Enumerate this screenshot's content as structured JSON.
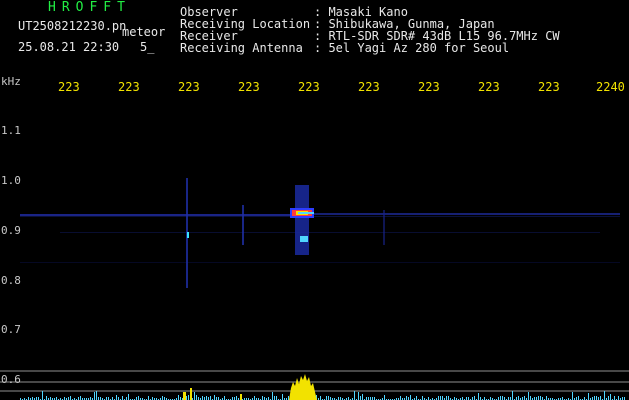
{
  "brand": "HROFFT",
  "file_name": "UT2508212230.pn",
  "mode": "meteor",
  "date_time": "25.08.21 22:30",
  "count": "5_",
  "info": [
    {
      "label": "Observer",
      "value": ": Masaki Kano"
    },
    {
      "label": "Receiving Location",
      "value": ": Shibukawa, Gunma, Japan"
    },
    {
      "label": "Receiver",
      "value": ": RTL-SDR SDR# 43dB L15 96.7MHz CW"
    },
    {
      "label": "Receiving Antenna",
      "value": ": 5el Yagi Az 280 for Seoul"
    }
  ],
  "y_unit": "kHz",
  "freq_labels": [
    "1.1",
    "1.0",
    "0.9",
    "0.8",
    "0.7",
    "0.6"
  ],
  "time_ticks": [
    "223",
    "223",
    "223",
    "223",
    "223",
    "223",
    "223",
    "223",
    "223",
    "2240"
  ],
  "colors": {
    "brand": "#22ee44",
    "header_text": "#e8e8e8",
    "tick_text": "#f2e200",
    "signal_yellow": "#f2e200",
    "noise_cyan": "#4fd6ff",
    "trace_blue": "#2c3cff"
  }
}
